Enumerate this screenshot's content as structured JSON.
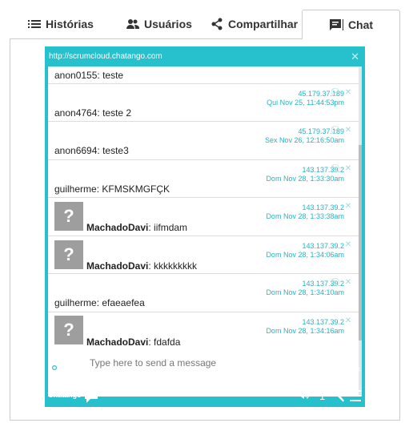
{
  "tabs": [
    {
      "label": "Histórias",
      "icon": "list-icon"
    },
    {
      "label": "Usuários",
      "icon": "users-icon"
    },
    {
      "label": "Compartilhar",
      "icon": "share-icon"
    },
    {
      "label": "Chat",
      "icon": "chat-icon",
      "active": true
    }
  ],
  "chat": {
    "url": "http://scrumcloud.chatango.com",
    "messages": [
      {
        "user": "anon0155",
        "text": "teste",
        "ip": "",
        "time": ""
      },
      {
        "user": "anon4764",
        "text": "teste 2",
        "ip": "45.179.37.189",
        "time": "Qui Nov 25, 11:44:53pm"
      },
      {
        "user": "anon6694",
        "text": "teste3",
        "ip": "45.179.37.189",
        "time": "Sex Nov 26, 12:16:50am"
      },
      {
        "user": "guilherme",
        "text": "KFMSKMGFÇK",
        "ip": "143.137.39.2",
        "time": "Dom Nov 28, 1:33:30am"
      },
      {
        "user": "MachadoDavi",
        "text": "iifmdam",
        "ip": "143.137.39.2",
        "time": "Dom Nov 28, 1:33:38am",
        "avatar": true
      },
      {
        "user": "MachadoDavi",
        "text": "kkkkkkkkk",
        "ip": "143.137.39.2",
        "time": "Dom Nov 28, 1:34:06am",
        "avatar": true
      },
      {
        "user": "guilherme",
        "text": "efaeaefea",
        "ip": "143.137.39.2",
        "time": "Dom Nov 28, 1:34:10am"
      },
      {
        "user": "MachadoDavi",
        "text": "fdafda",
        "ip": "143.137.39.2",
        "time": "Dom Nov 28, 1:34:16am",
        "avatar": true
      }
    ],
    "input_placeholder": "Type here to send a message",
    "brand": "Chatango",
    "user_count": "1",
    "avatar_glyph": "?",
    "accent_color": "#26c1cc"
  }
}
